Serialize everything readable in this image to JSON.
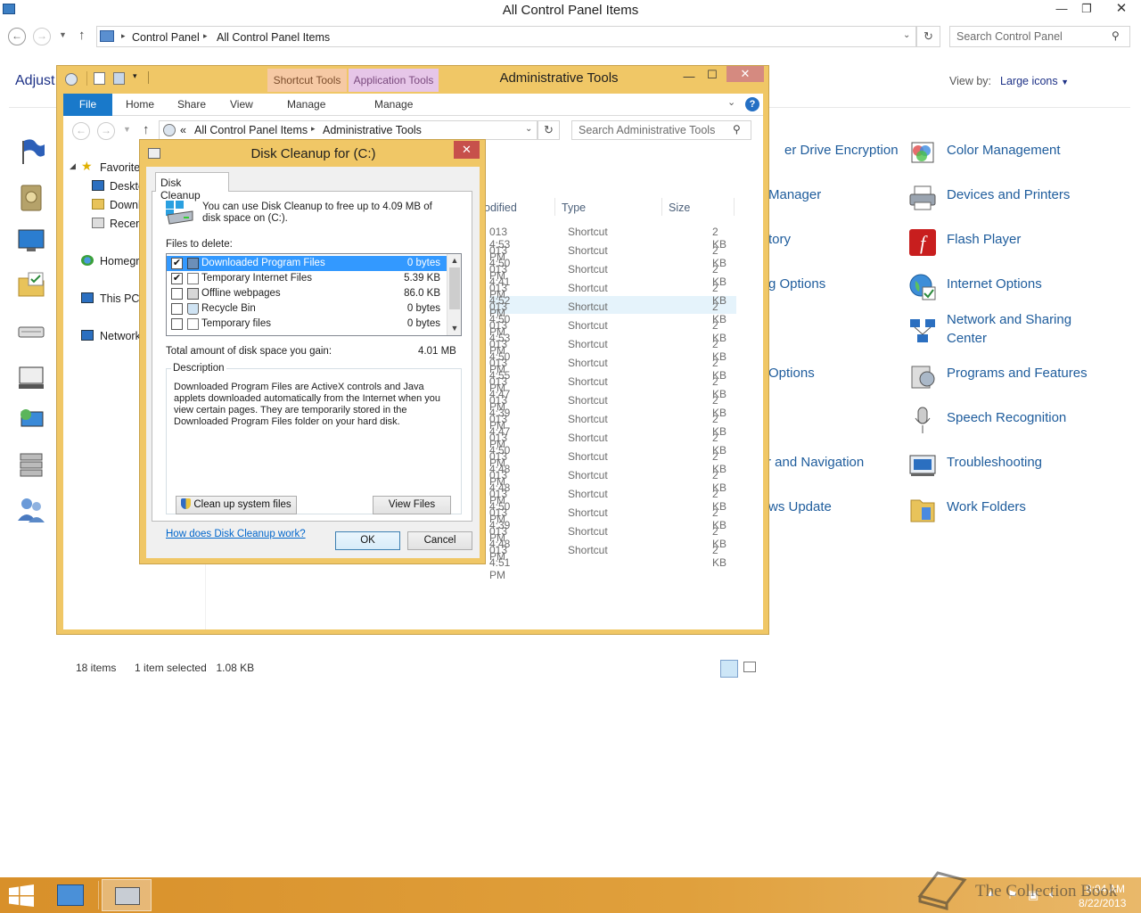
{
  "control_panel": {
    "title": "All Control Panel Items",
    "breadcrumb": [
      "Control Panel",
      "All Control Panel Items"
    ],
    "search_placeholder": "Search Control Panel",
    "heading": "Adjust",
    "view_by_label": "View by:",
    "view_by_value": "Large icons",
    "items_right": [
      {
        "label": "Color Management",
        "icon": "color-management-icon"
      },
      {
        "label": "Devices and Printers",
        "icon": "printer-icon"
      },
      {
        "label": "Flash Player",
        "icon": "flash-icon"
      },
      {
        "label": "Internet Options",
        "icon": "globe-icon"
      },
      {
        "label": "Network and Sharing",
        "label2": "Center",
        "icon": "network-icon"
      },
      {
        "label": "Programs and Features",
        "icon": "programs-icon"
      },
      {
        "label": "Speech Recognition",
        "icon": "microphone-icon"
      },
      {
        "label": "Troubleshooting",
        "icon": "troubleshoot-icon"
      },
      {
        "label": "Work Folders",
        "icon": "folder-icon"
      }
    ],
    "items_middle": [
      "er Drive Encryption",
      "Manager",
      "tory",
      "g Options",
      "Options",
      "r and Navigation",
      "ws Update"
    ]
  },
  "admin_tools": {
    "title": "Administrative Tools",
    "context_tabs": [
      "Shortcut Tools",
      "Application Tools"
    ],
    "ribbon_tabs": [
      "File",
      "Home",
      "Share",
      "View",
      "Manage",
      "Manage"
    ],
    "breadcrumb_prefix": "«",
    "breadcrumb": [
      "All Control Panel Items",
      "Administrative Tools"
    ],
    "search_placeholder": "Search Administrative Tools",
    "nav": {
      "favorites": "Favorites",
      "desktop": "Deskto",
      "downloads": "Downl",
      "recent": "Recent",
      "homegroup": "Homegr",
      "thispc": "This PC",
      "network": "Network"
    },
    "columns": {
      "modified": "odified",
      "type": "Type",
      "size": "Size"
    },
    "rows": [
      {
        "time": "013 4:53 PM",
        "type": "Shortcut",
        "size": "2 KB"
      },
      {
        "time": "013 4:50 PM",
        "type": "Shortcut",
        "size": "2 KB"
      },
      {
        "time": "013 4:41 PM",
        "type": "Shortcut",
        "size": "2 KB"
      },
      {
        "time": "013 4:52 PM",
        "type": "Shortcut",
        "size": "2 KB"
      },
      {
        "time": "013 4:50 PM",
        "type": "Shortcut",
        "size": "2 KB"
      },
      {
        "time": "013 4:53 PM",
        "type": "Shortcut",
        "size": "2 KB"
      },
      {
        "time": "013 4:50 PM",
        "type": "Shortcut",
        "size": "2 KB"
      },
      {
        "time": "013 4:55 PM",
        "type": "Shortcut",
        "size": "2 KB"
      },
      {
        "time": "013 4:47 PM",
        "type": "Shortcut",
        "size": "2 KB"
      },
      {
        "time": "013 4:39 PM",
        "type": "Shortcut",
        "size": "2 KB"
      },
      {
        "time": "013 4:47 PM",
        "type": "Shortcut",
        "size": "2 KB"
      },
      {
        "time": "013 4:50 PM",
        "type": "Shortcut",
        "size": "2 KB"
      },
      {
        "time": "013 4:48 PM",
        "type": "Shortcut",
        "size": "2 KB"
      },
      {
        "time": "013 4:48 PM",
        "type": "Shortcut",
        "size": "2 KB"
      },
      {
        "time": "013 4:50 PM",
        "type": "Shortcut",
        "size": "2 KB"
      },
      {
        "time": "013 4:39 PM",
        "type": "Shortcut",
        "size": "2 KB"
      },
      {
        "time": "013 4:48 PM",
        "type": "Shortcut",
        "size": "2 KB"
      },
      {
        "time": "013 4:51 PM",
        "type": "Shortcut",
        "size": "2 KB"
      }
    ],
    "status": {
      "count": "18 items",
      "selection": "1 item selected",
      "size": "1.08 KB"
    }
  },
  "disk_cleanup": {
    "title": "Disk Cleanup for  (C:)",
    "close_glyph": "✕",
    "tab": "Disk Cleanup",
    "intro": "You can use Disk Cleanup to free up to 4.09 MB of disk space on  (C:).",
    "files_to_delete": "Files to delete:",
    "files": [
      {
        "name": "Downloaded Program Files",
        "size": "0 bytes",
        "checked": true,
        "selected": true
      },
      {
        "name": "Temporary Internet Files",
        "size": "5.39 KB",
        "checked": true,
        "selected": false
      },
      {
        "name": "Offline webpages",
        "size": "86.0 KB",
        "checked": false,
        "selected": false
      },
      {
        "name": "Recycle Bin",
        "size": "0 bytes",
        "checked": false,
        "selected": false
      },
      {
        "name": "Temporary files",
        "size": "0 bytes",
        "checked": false,
        "selected": false
      }
    ],
    "total_label": "Total amount of disk space you gain:",
    "total_value": "4.01 MB",
    "description_label": "Description",
    "description": "Downloaded Program Files are ActiveX controls and Java applets downloaded automatically from the Internet when you view certain pages. They are temporarily stored in the Downloaded Program Files folder on your hard disk.",
    "cleanup_system_button": "Clean up system files",
    "view_files_button": "View Files",
    "help_link": "How does Disk Cleanup work?",
    "ok": "OK",
    "cancel": "Cancel"
  },
  "taskbar": {
    "time": "8:04 AM",
    "date": "8/22/2013",
    "watermark": "The Collection Book"
  },
  "colors": {
    "accent_frame": "#f0c766",
    "file_tab": "#1979ca",
    "close_red": "#c7504b",
    "selection_blue": "#3399ff",
    "link_green": "#1a7a3c"
  }
}
